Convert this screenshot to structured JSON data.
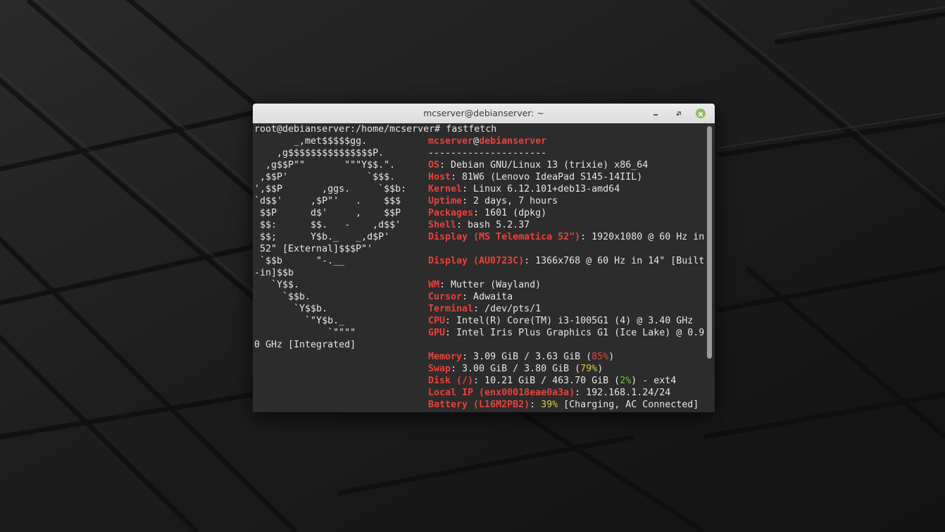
{
  "window": {
    "title": "mcserver@debianserver: ~"
  },
  "terminal": {
    "prompt_line": "root@debianserver:/home/mcserver# fastfetch",
    "logo_lines": [
      "       _,met$$$$$gg.",
      "    ,g$$$$$$$$$$$$$$$P.",
      "  ,g$$P\"\"       \"\"\"Y$$.\".",
      " ,$$P'              `$$$.",
      "',$$P       ,ggs.     `$$b:",
      "`d$$'     ,$P\"'   .    $$$",
      " $$P      d$'     ,    $$P",
      " $$:      $$.   -    ,d$$'",
      " $$;      Y$b._   _,d$P'",
      " 52\" [External]$$$P\"'",
      " `$$b      \"-.__",
      "-in]$$b",
      "   `Y$$.",
      "     `$$b.",
      "       `Y$$b.",
      "         `\"Y$b._",
      "             `\"\"\"\"",
      "0 GHz [Integrated]"
    ],
    "user": "mcserver",
    "at": "@",
    "host": "debianserver",
    "separator": "---------------------",
    "info": {
      "os_key": "OS",
      "os_val": ": Debian GNU/Linux 13 (trixie) x86_64",
      "host_key": "Host",
      "host_val": ": 81W6 (Lenovo IdeaPad S145-14IIL)",
      "kernel_key": "Kernel",
      "kernel_val": ": Linux 6.12.101+deb13-amd64",
      "uptime_key": "Uptime",
      "uptime_val": ": 2 days, 7 hours",
      "packages_key": "Packages",
      "packages_val": ": 1601 (dpkg)",
      "shell_key": "Shell",
      "shell_val": ": bash 5.2.37",
      "display1_key": "Display (MS Telematica 52\")",
      "display1_val": ": 1920x1080 @ 60 Hz in",
      "display2_key": "Display (AU0723C)",
      "display2_val": ": 1366x768 @ 60 Hz in 14\" [Built",
      "wm_key": "WM",
      "wm_val": ": Mutter (Wayland)",
      "cursor_key": "Cursor",
      "cursor_val": ": Adwaita",
      "terminal_key": "Terminal",
      "terminal_val": ": /dev/pts/1",
      "cpu_key": "CPU",
      "cpu_val": ": Intel(R) Core(TM) i3-1005G1 (4) @ 3.40 GHz",
      "gpu_key": "GPU",
      "gpu_val": ": Intel Iris Plus Graphics G1 (Ice Lake) @ 0.9",
      "memory_key": "Memory",
      "memory_val": ": 3.09 GiB / 3.63 GiB (",
      "memory_pct": "85%",
      "memory_end": ")",
      "swap_key": "Swap",
      "swap_val": ": 3.00 GiB / 3.80 GiB (",
      "swap_pct": "79%",
      "swap_end": ")",
      "disk_key": "Disk (/)",
      "disk_val": ": 10.21 GiB / 463.70 GiB (",
      "disk_pct": "2%",
      "disk_end": ") - ext4",
      "localip_key": "Local IP (enx00018eae0a3a)",
      "localip_val": ": 192.168.1.24/24",
      "battery_key": "Battery (L16M2PB2)",
      "battery_sep": ": ",
      "battery_pct": "39%",
      "battery_end": " [Charging, AC Connected]"
    }
  },
  "colors": {
    "key_red": "#e8423e",
    "ok_green": "#6fbf3c",
    "warn_yellow": "#d8c547"
  }
}
